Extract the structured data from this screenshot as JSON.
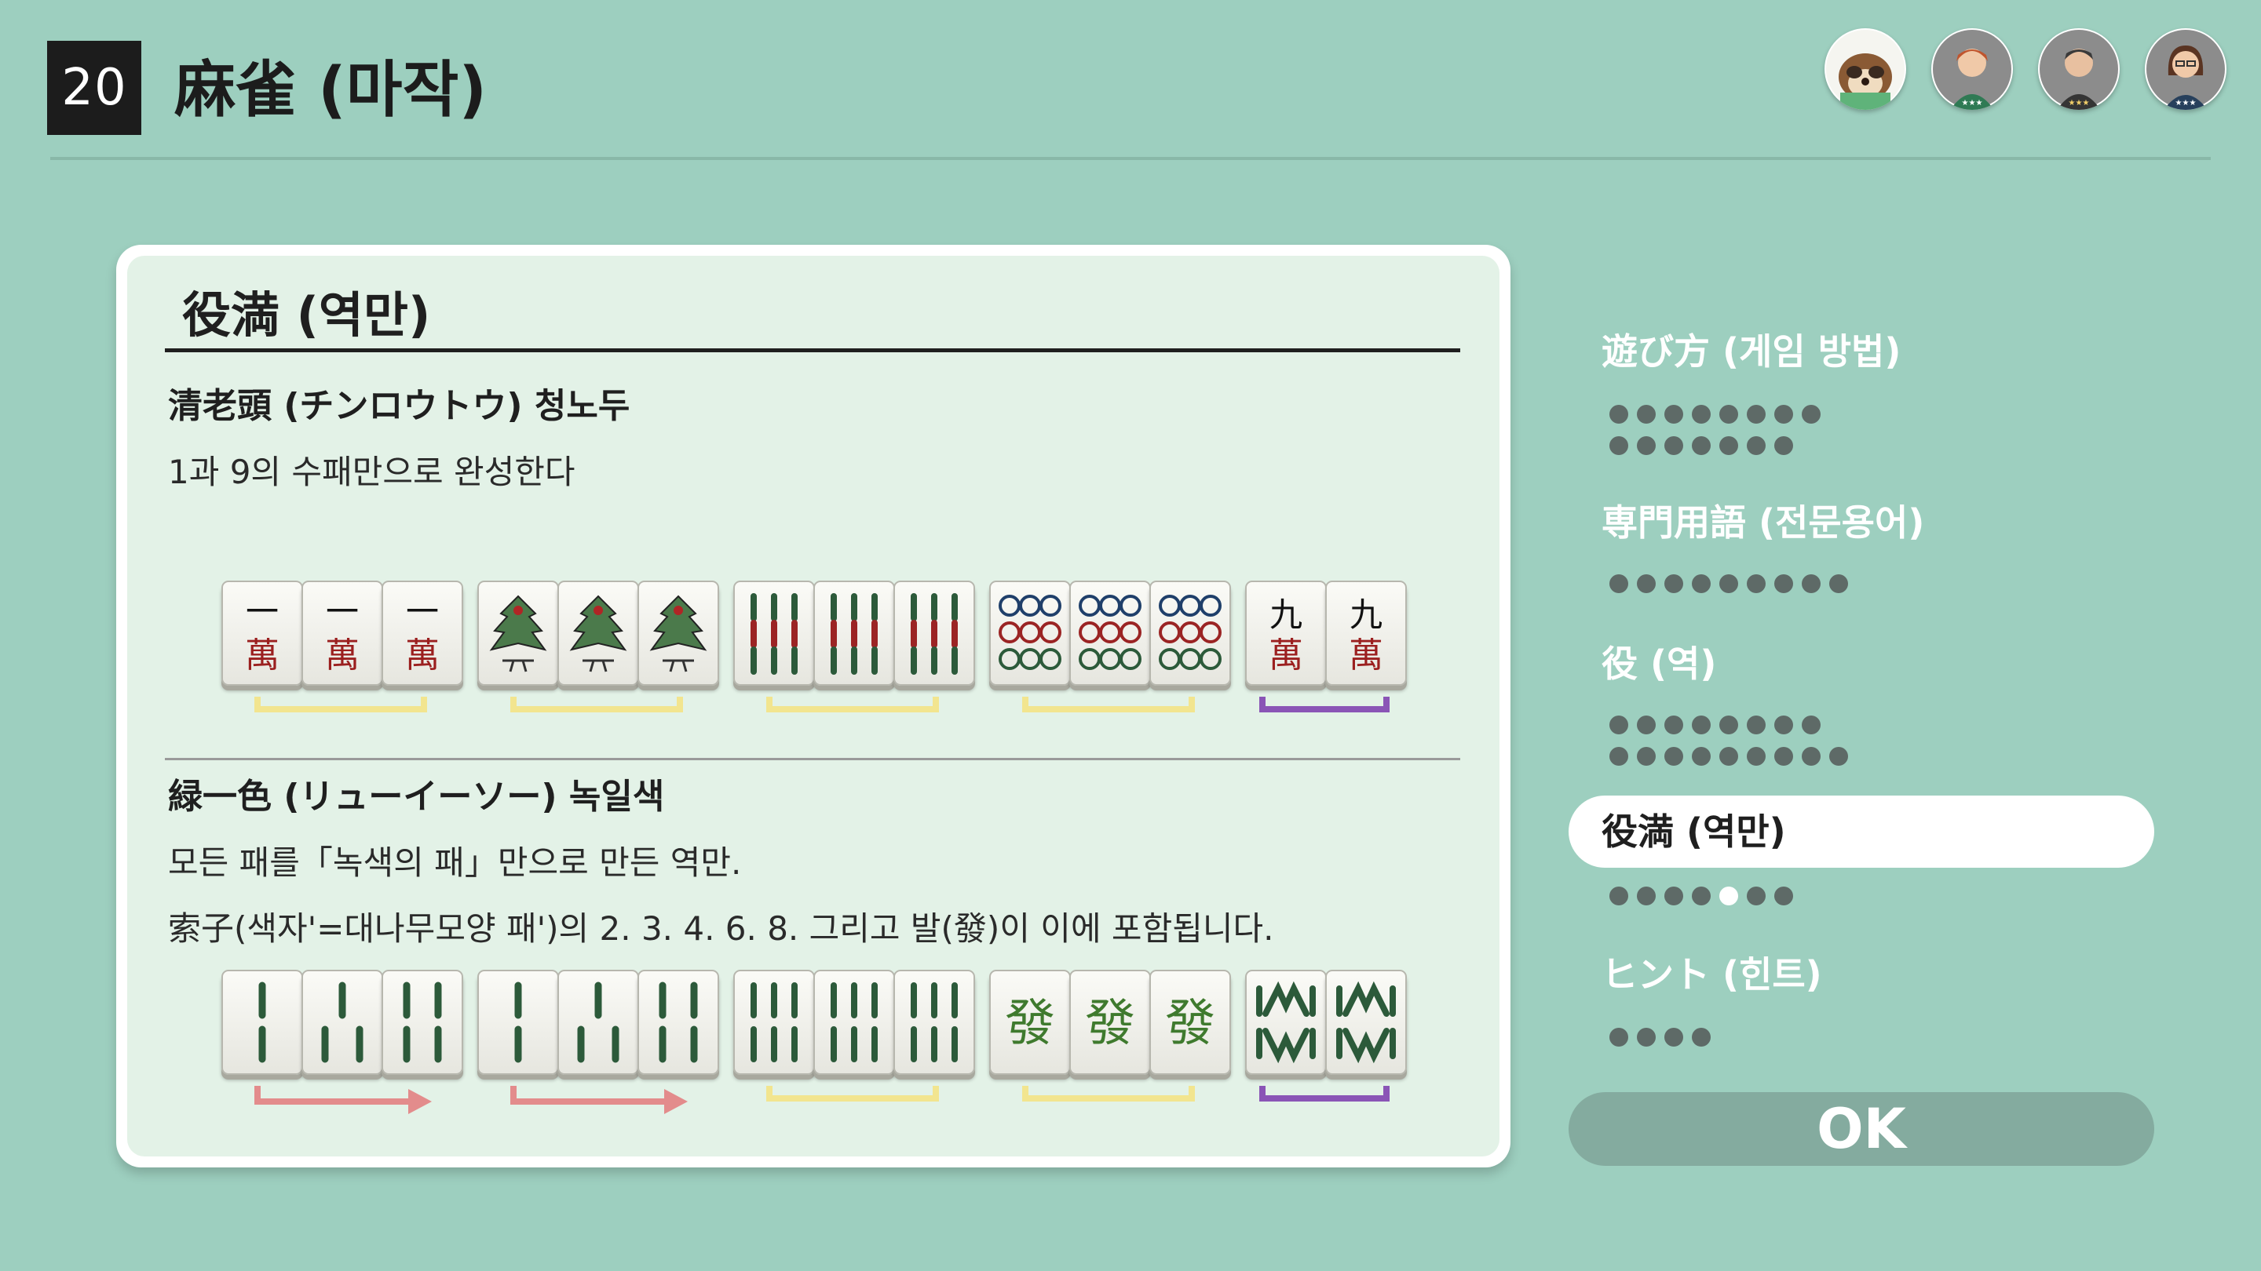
{
  "header": {
    "game_number": "20",
    "title": "麻雀 (마작)"
  },
  "players": [
    {
      "name": "tanuki-avatar"
    },
    {
      "name": "player-avatar-1"
    },
    {
      "name": "player-avatar-2"
    },
    {
      "name": "player-avatar-3"
    }
  ],
  "section": {
    "title": "役満 (역만)",
    "yaku1": {
      "title": "清老頭 (チンロウトウ) 청노두",
      "desc": "1과 9의 수패만으로 완성한다"
    },
    "yaku2": {
      "title": "緑一色 (リューイーソー) 녹일색",
      "desc1": "모든 패를「녹색의 패」만으로 만든 역만.",
      "desc2": "索子(색자'=대나무모양 패')의 2. 3. 4. 6. 8. 그리고 발(發)이 이에 포함됩니다."
    }
  },
  "tiles": {
    "row1": [
      {
        "group": "1-man set",
        "kind": "chi",
        "glyphs": [
          "一",
          "一",
          "一"
        ],
        "suit": "萬"
      },
      {
        "group": "1-sou set",
        "kind": "bird"
      },
      {
        "group": "9-sou set",
        "kind": "bamboo9"
      },
      {
        "group": "9-pin set",
        "kind": "circle9"
      },
      {
        "group": "9-man pair",
        "glyphs": [
          "九",
          "九"
        ],
        "suit": "萬"
      }
    ],
    "row2": [
      {
        "group": "2-3-4 sou",
        "kind": "bamboo-run-234"
      },
      {
        "group": "2-3-4 sou",
        "kind": "bamboo-run-234"
      },
      {
        "group": "6-sou set",
        "kind": "bamboo6"
      },
      {
        "group": "hatsu set",
        "glyph": "發"
      },
      {
        "group": "8-sou pair",
        "kind": "bamboo8"
      }
    ]
  },
  "menu": {
    "items": [
      {
        "label": "遊び方 (게임 방법)",
        "dots": 15,
        "active": -1
      },
      {
        "label": "専門用語 (전문용어)",
        "dots": 9,
        "active": -1
      },
      {
        "label": "役 (역)",
        "dots": 17,
        "active": -1
      },
      {
        "label": "役満 (역만)",
        "dots": 7,
        "active": 4
      },
      {
        "label": "ヒント (힌트)",
        "dots": 4,
        "active": -1
      }
    ],
    "ok_label": "OK"
  },
  "colors": {
    "background": "#9dcfbf",
    "card": "#e3f2e7",
    "bracket_yellow": "#f2e58f",
    "bracket_purple": "#8a55b6",
    "arrow_red": "#e38c8c",
    "ok_button": "#84ab9f"
  }
}
